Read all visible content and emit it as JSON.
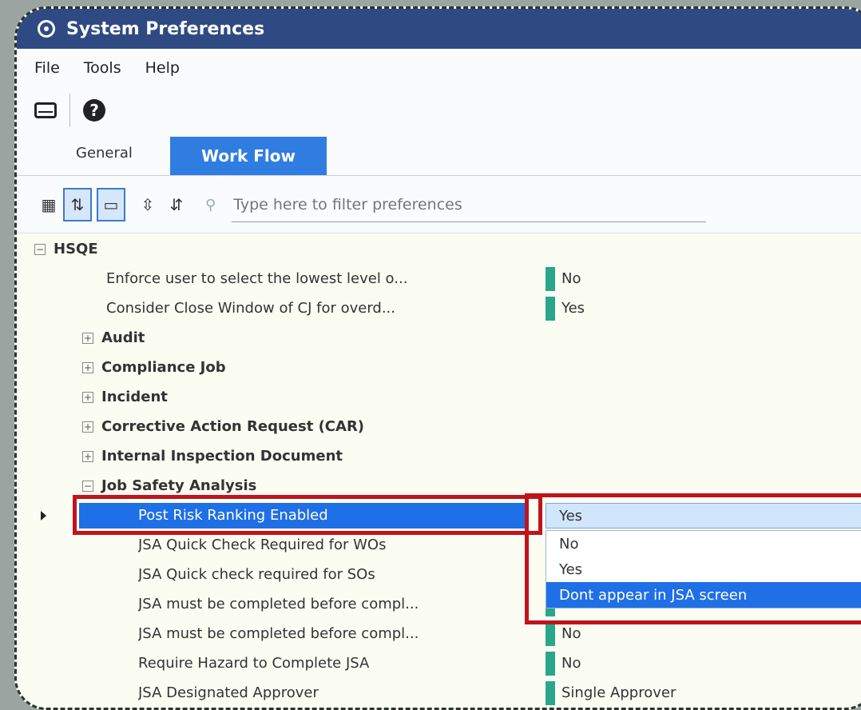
{
  "window": {
    "title": "System Preferences"
  },
  "menu": [
    "File",
    "Tools",
    "Help"
  ],
  "toolbar": {
    "save_icon": "drive-icon",
    "help_icon": "?"
  },
  "tabs": {
    "general": "General",
    "workflow": "Work Flow"
  },
  "filter": {
    "placeholder": "Type here to filter preferences"
  },
  "tree": {
    "root_group": "HSQE",
    "root_items": [
      {
        "name": "Enforce user to select the lowest level o...",
        "value": "No"
      },
      {
        "name": "Consider Close Window of CJ for overd...",
        "value": "Yes"
      }
    ],
    "collapsed_groups": [
      "Audit",
      "Compliance Job",
      "Incident",
      "Corrective Action Request (CAR)",
      "Internal Inspection Document"
    ],
    "expanded_group": "Job Safety Analysis",
    "selected_item": {
      "name": "Post Risk Ranking Enabled",
      "value": "Yes"
    },
    "jsa_items": [
      {
        "name": "JSA Quick Check Required for WOs",
        "value": ""
      },
      {
        "name": "JSA Quick check required for SOs",
        "value": ""
      },
      {
        "name": "JSA must be completed before compl...",
        "value": ""
      },
      {
        "name": "JSA must be completed before compl...",
        "value": "No"
      },
      {
        "name": "Require Hazard to Complete JSA",
        "value": "No"
      },
      {
        "name": "JSA Designated Approver",
        "value": "Single Approver"
      }
    ]
  },
  "dropdown": {
    "current": "Yes",
    "options": [
      "No",
      "Yes",
      "Dont appear in JSA screen"
    ],
    "highlighted": "Dont appear in JSA screen"
  },
  "colors": {
    "titlebar": "#2f4a83",
    "tab_active": "#2f7de1",
    "selection": "#1f6fe6",
    "value_marker": "#2aa78a",
    "annotation_box": "#c0141c"
  }
}
